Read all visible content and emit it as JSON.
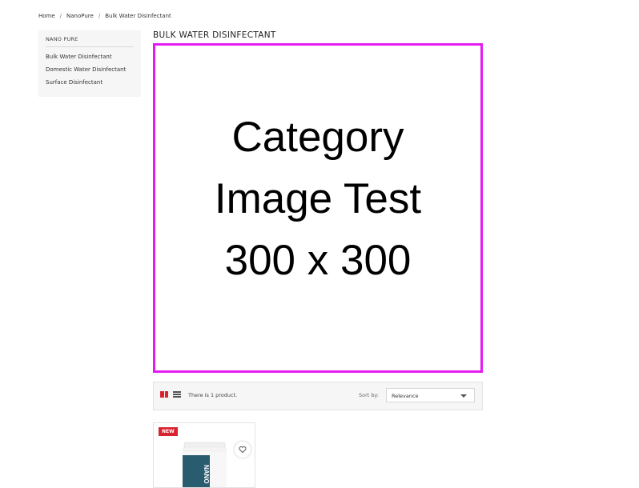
{
  "breadcrumb": {
    "items": [
      "Home",
      "NanoPure",
      "Bulk Water Disinfectant"
    ],
    "separator": "/"
  },
  "sidebar": {
    "title": "NANO PURE",
    "items": [
      "Bulk Water Disinfectant",
      "Domestic Water Disinfectant",
      "Surface Disinfectant"
    ]
  },
  "category": {
    "title": "BULK WATER DISINFECTANT",
    "image_lines": [
      "Category",
      "Image Test",
      "300 x 300"
    ],
    "image_border_color": "#e41cf0"
  },
  "toolbar": {
    "count_text": "There is 1 product.",
    "sort_label": "Sort by:",
    "sort_value": "Relevance"
  },
  "product": {
    "badge": "NEW",
    "wishlist_icon": "heart-icon",
    "label_text": "NANO"
  },
  "colors": {
    "accent": "#d9232e",
    "jar_label": "#2a5c70"
  }
}
